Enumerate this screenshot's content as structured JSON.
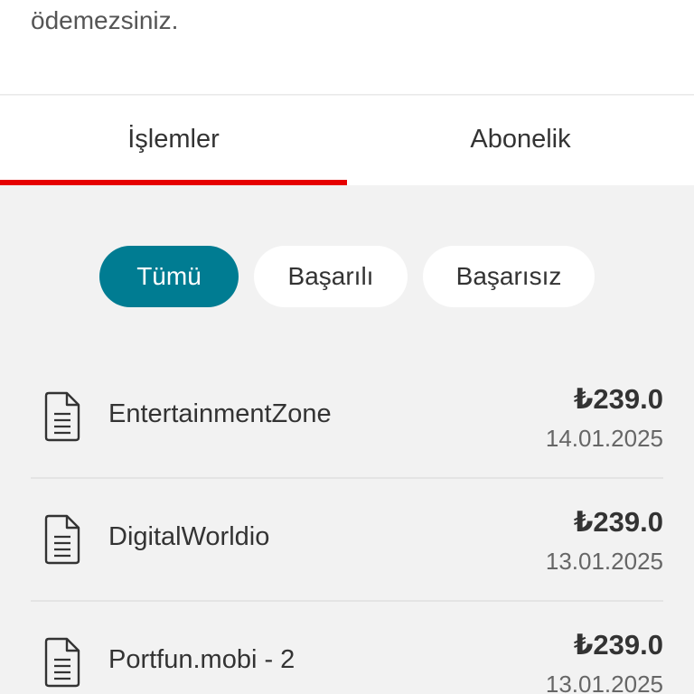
{
  "intro": {
    "text": "ödemezsiniz."
  },
  "tabs": [
    {
      "label": "İşlemler",
      "active": true
    },
    {
      "label": "Abonelik",
      "active": false
    }
  ],
  "filters": [
    {
      "label": "Tümü",
      "active": true
    },
    {
      "label": "Başarılı",
      "active": false
    },
    {
      "label": "Başarısız",
      "active": false
    }
  ],
  "transactions": [
    {
      "name": "EntertainmentZone",
      "amount": "₺239.0",
      "date": "14.01.2025",
      "icon": "document-icon"
    },
    {
      "name": "DigitalWorldio",
      "amount": "₺239.0",
      "date": "13.01.2025",
      "icon": "document-icon"
    },
    {
      "name": "Portfun.mobi - 2",
      "amount": "₺239.0",
      "date": "13.01.2025",
      "icon": "document-icon"
    }
  ],
  "colors": {
    "accent_red": "#e60000",
    "active_chip": "#007c92",
    "background": "#f2f2f2"
  }
}
